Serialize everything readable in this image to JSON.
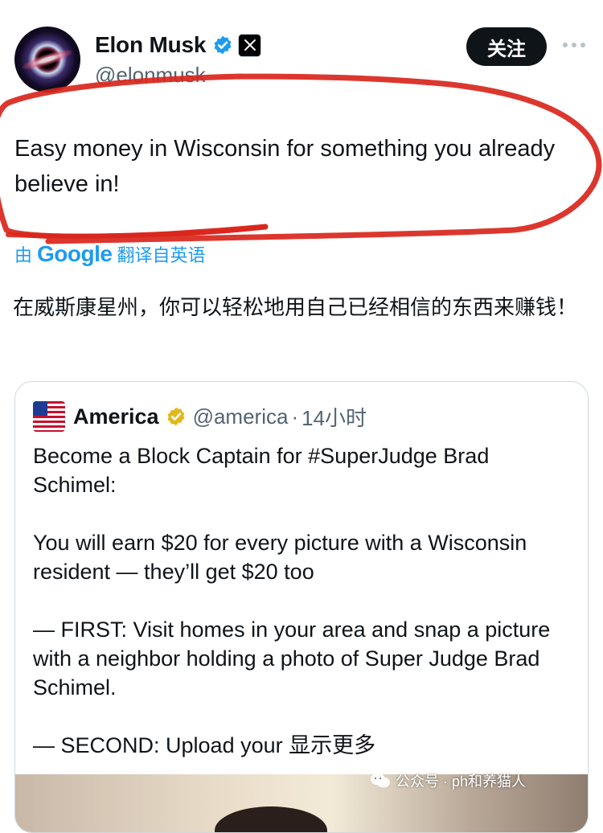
{
  "author": {
    "name": "Elon Musk",
    "handle": "@elonmusk",
    "verified_color": "#1d9bf0",
    "follow_label": "关注"
  },
  "tweet": {
    "text": "Easy money in Wisconsin for something you already believe in!",
    "translate_label": "由 Google 翻译自英语",
    "translate_prefix": "由",
    "translate_brand": "Google",
    "translate_suffix": "翻译自英语",
    "translated_text": "在威斯康星州，你可以轻松地用自己已经相信的东西来赚钱！"
  },
  "quote": {
    "name": "America",
    "handle": "@america",
    "separator": "·",
    "time": "14小时",
    "badge_color": "#e2b719",
    "paragraphs": [
      "Become a Block Captain for #SuperJudge Brad Schimel:",
      "You will earn $20 for every picture with a Wisconsin resident — they’ll get $20 too",
      "— FIRST: Visit homes in your area and snap a picture with a neighbor holding a photo of Super Judge Brad Schimel.",
      "— SECOND: Upload your"
    ],
    "show_more": "显示更多"
  },
  "watermark": {
    "text": "公众号 · ph和养猫人",
    "brand": "养猫人"
  },
  "colors": {
    "annotation_red": "#d9261c",
    "link_blue": "#1d9bf0"
  },
  "icons": {
    "more": "more-horizontal-icon",
    "verified": "verified-check-icon",
    "affiliate": "x-affiliate-icon",
    "flag": "us-flag-icon",
    "gold_check": "gold-check-icon",
    "wechat": "wechat-icon"
  }
}
